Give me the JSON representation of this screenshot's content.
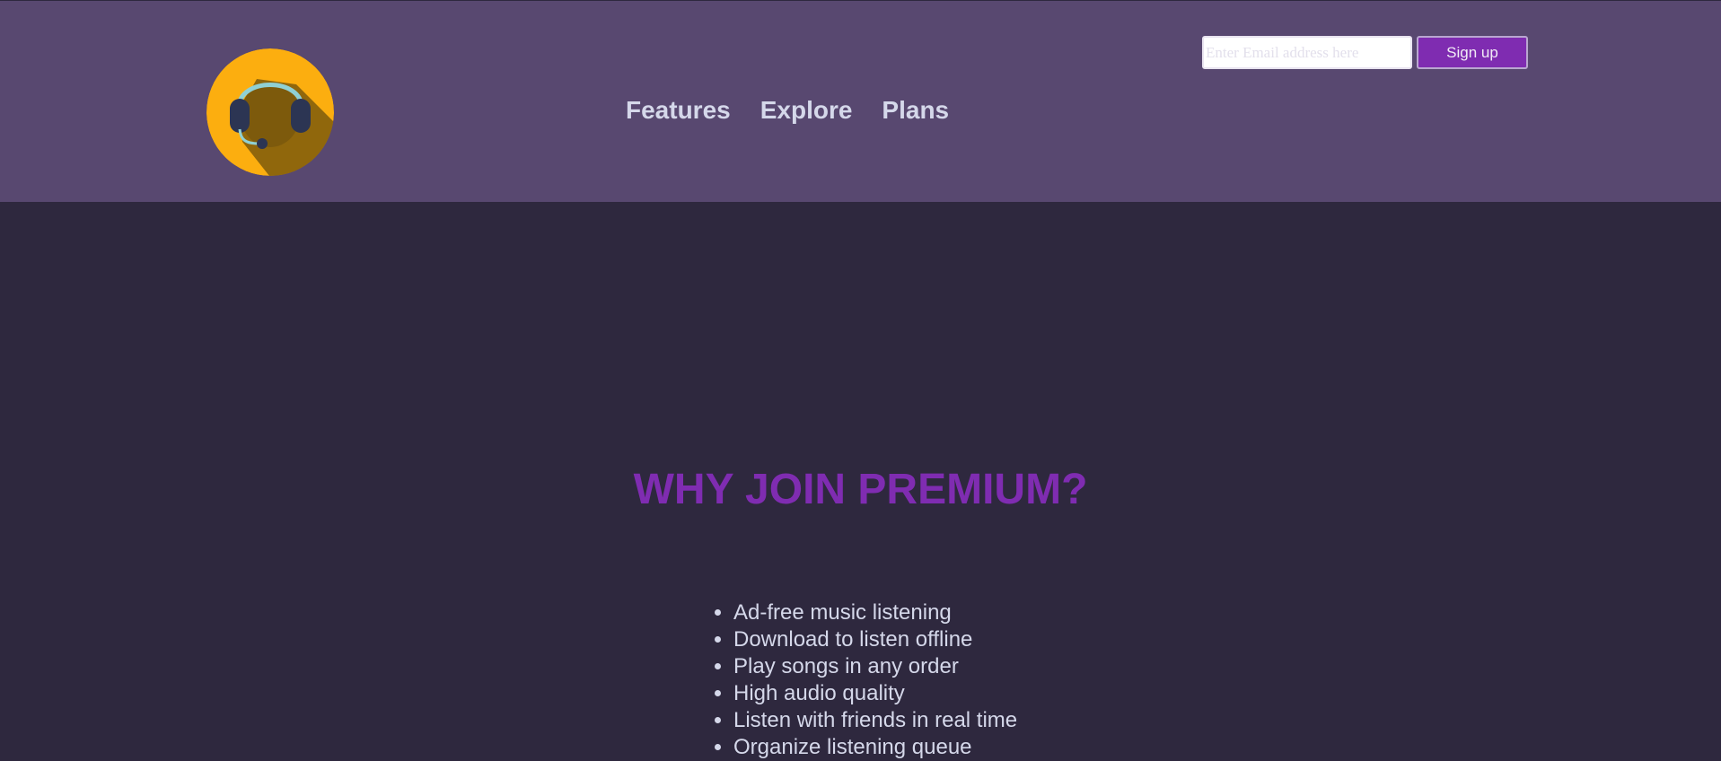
{
  "header": {
    "logo": {
      "icon": "headset-icon",
      "colors": {
        "circle": "#fcae0f",
        "shadow": "#7d5a0c",
        "headband": "#8fd0d4",
        "earcup": "#2c3553"
      }
    },
    "nav": [
      {
        "label": "Features"
      },
      {
        "label": "Explore"
      },
      {
        "label": "Plans"
      }
    ],
    "email": {
      "value": "",
      "placeholder": "Enter Email address here"
    },
    "signup_label": "Sign up"
  },
  "main": {
    "headline": "WHY JOIN PREMIUM?",
    "perks": [
      "Ad-free music listening",
      "Download to listen offline",
      "Play songs in any order",
      "High audio quality",
      "Listen with friends in real time",
      "Organize listening queue"
    ]
  },
  "colors": {
    "header_bg": "#584870",
    "page_bg": "#2e283e",
    "accent": "#7f2cb1",
    "nav_text": "#d5d8ea"
  }
}
